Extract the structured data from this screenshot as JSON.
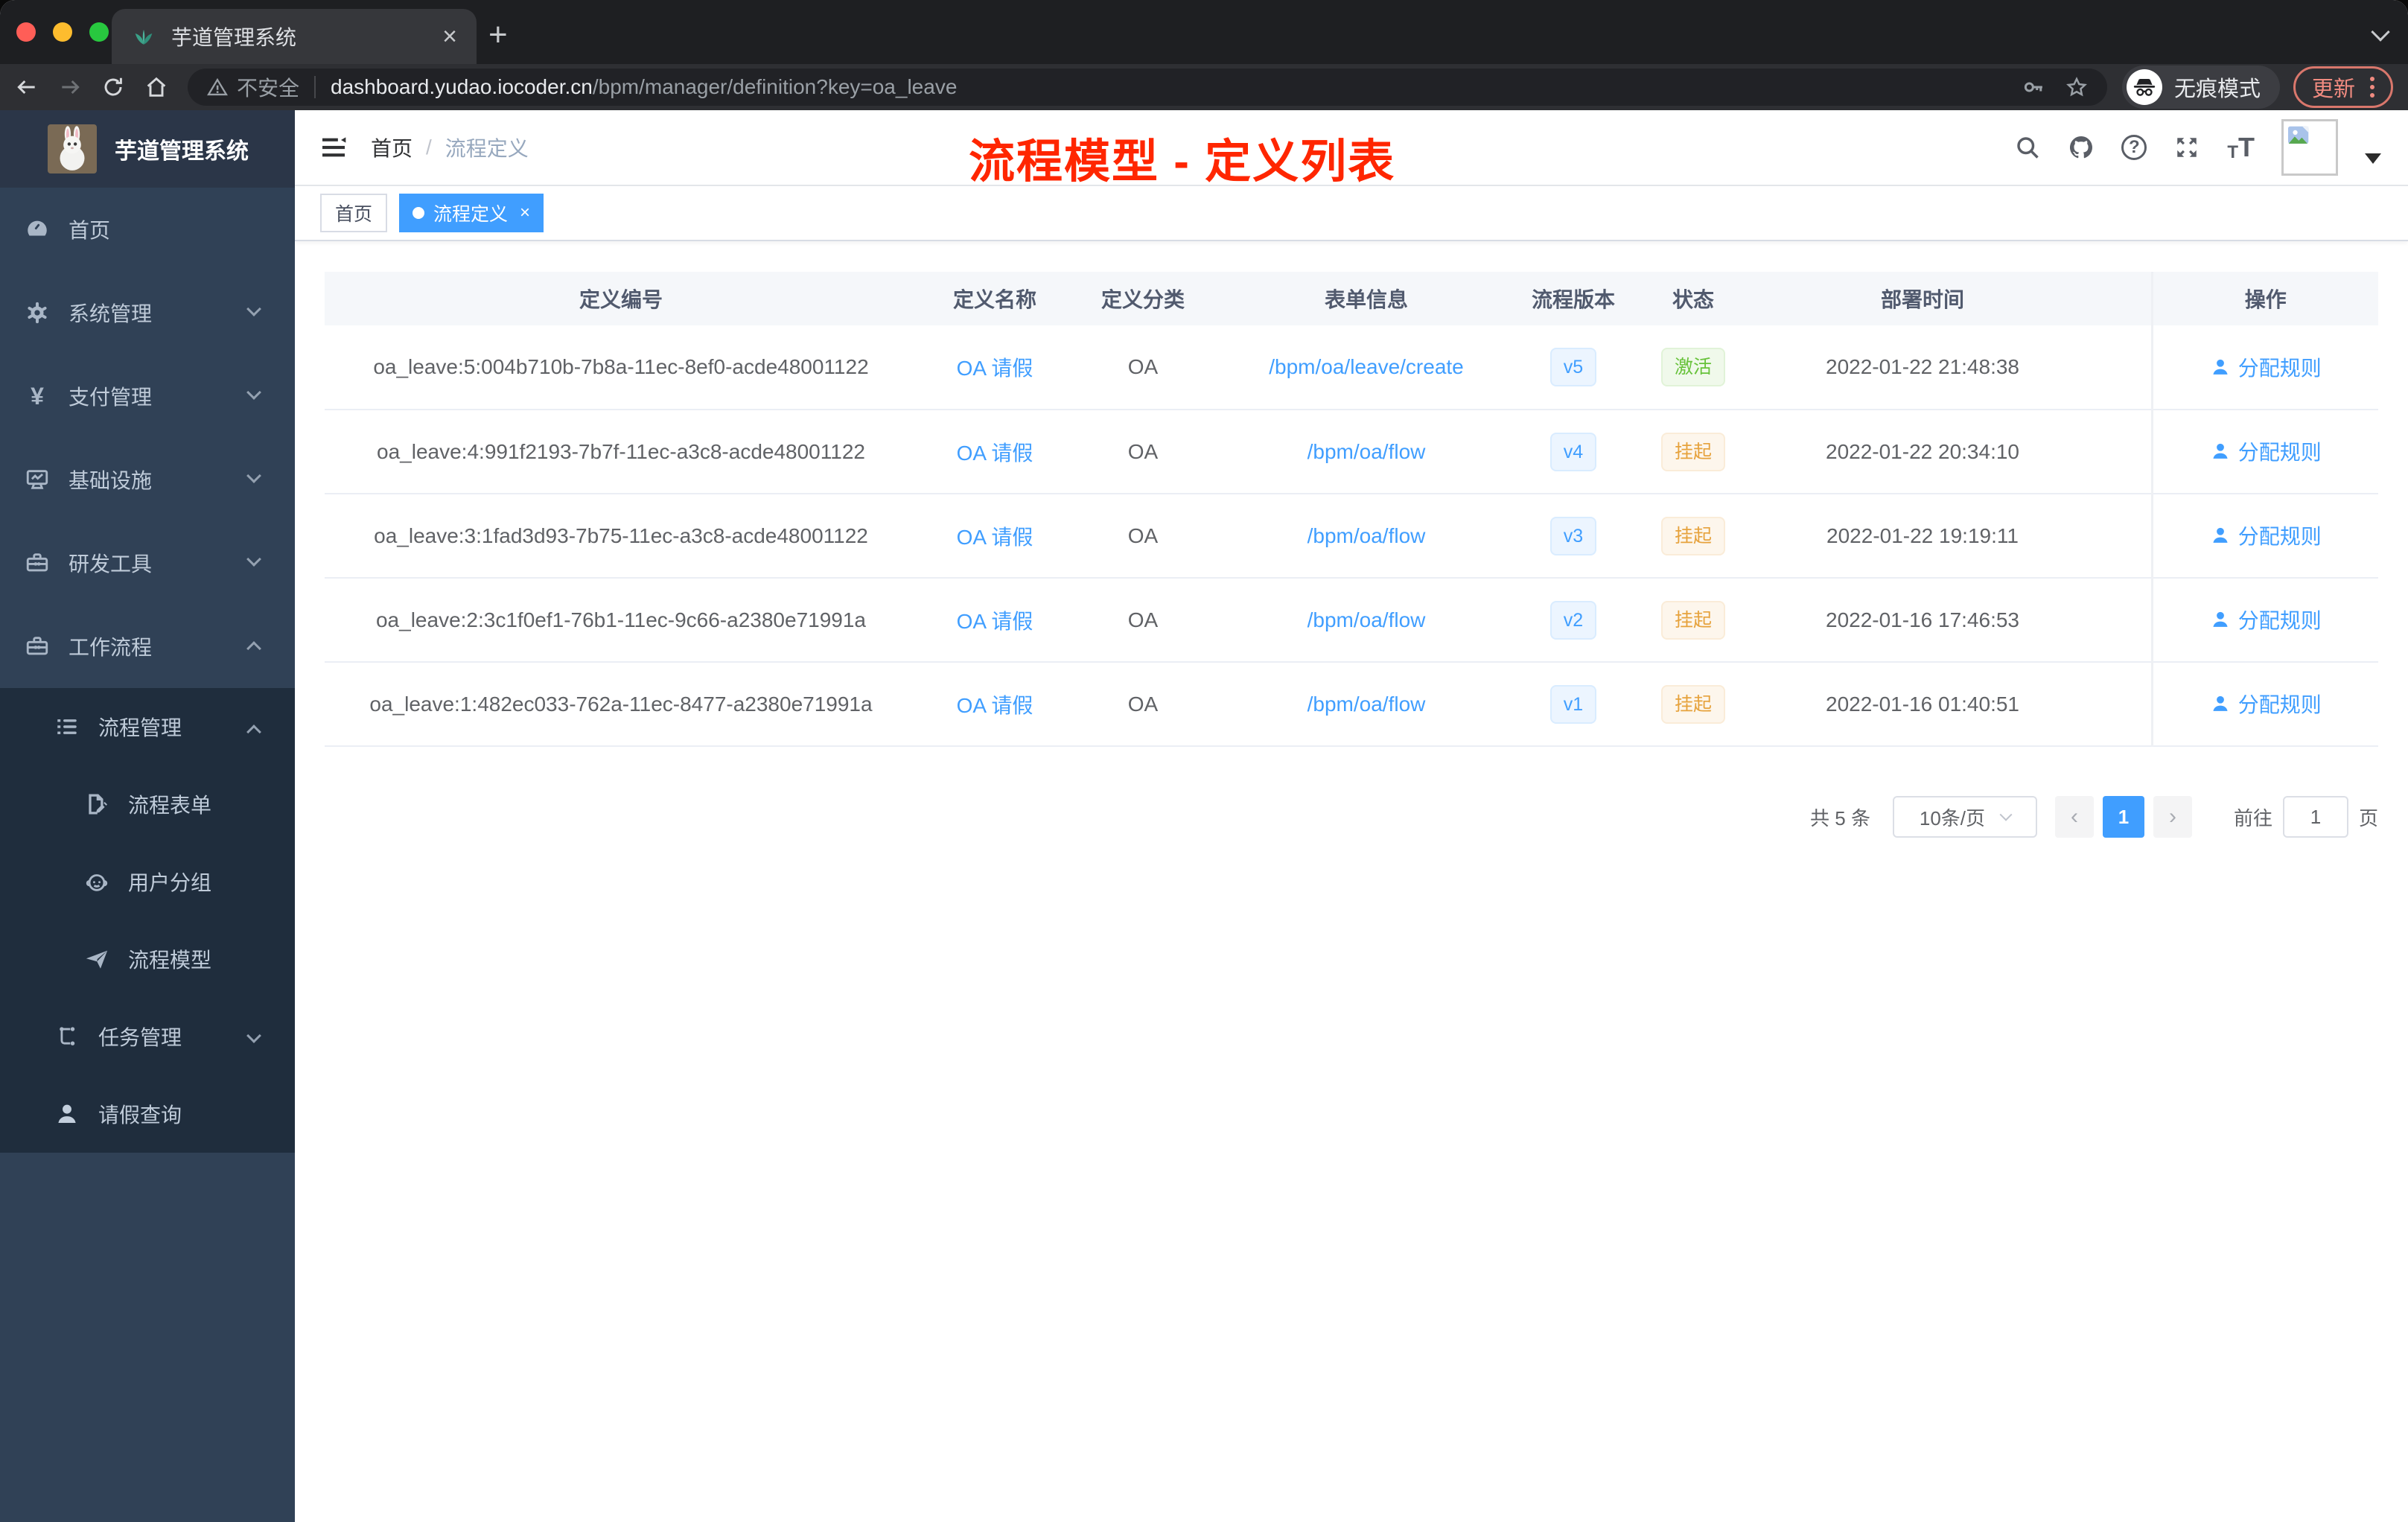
{
  "browser": {
    "tab_title": "芋道管理系统",
    "tab_close": "×",
    "new_tab": "+",
    "security_label": "不安全",
    "url_host": "dashboard.yudao.iocoder.cn",
    "url_path": "/bpm/manager/definition?key=oa_leave",
    "incognito_label": "无痕模式",
    "update_label": "更新"
  },
  "sidebar": {
    "title": "芋道管理系统",
    "yen_glyph": "¥",
    "items": [
      {
        "label": "首页"
      },
      {
        "label": "系统管理"
      },
      {
        "label": "支付管理"
      },
      {
        "label": "基础设施"
      },
      {
        "label": "研发工具"
      },
      {
        "label": "工作流程"
      },
      {
        "label": "流程管理"
      },
      {
        "label": "流程表单"
      },
      {
        "label": "用户分组"
      },
      {
        "label": "流程模型"
      },
      {
        "label": "任务管理"
      },
      {
        "label": "请假查询"
      }
    ]
  },
  "header": {
    "breadcrumb_home": "首页",
    "breadcrumb_sep": "/",
    "breadcrumb_current": "流程定义",
    "help_glyph": "?",
    "font_glyph_small": "T",
    "font_glyph_big": "T"
  },
  "tags": {
    "home": "首页",
    "active": "流程定义",
    "close": "×"
  },
  "annotation": {
    "text": "流程模型 - 定义列表",
    "color": "#ff2600"
  },
  "table": {
    "headers": [
      "定义编号",
      "定义名称",
      "定义分类",
      "表单信息",
      "流程版本",
      "状态",
      "部署时间",
      "操作"
    ],
    "rows": [
      {
        "id": "oa_leave:5:004b710b-7b8a-11ec-8ef0-acde48001122",
        "name": "OA 请假",
        "category": "OA",
        "form": "/bpm/oa/leave/create",
        "version": "v5",
        "status": "激活",
        "time": "2022-01-22 21:48:38",
        "action": "分配规则"
      },
      {
        "id": "oa_leave:4:991f2193-7b7f-11ec-a3c8-acde48001122",
        "name": "OA 请假",
        "category": "OA",
        "form": "/bpm/oa/flow",
        "version": "v4",
        "status": "挂起",
        "time": "2022-01-22 20:34:10",
        "action": "分配规则"
      },
      {
        "id": "oa_leave:3:1fad3d93-7b75-11ec-a3c8-acde48001122",
        "name": "OA 请假",
        "category": "OA",
        "form": "/bpm/oa/flow",
        "version": "v3",
        "status": "挂起",
        "time": "2022-01-22 19:19:11",
        "action": "分配规则"
      },
      {
        "id": "oa_leave:2:3c1f0ef1-76b1-11ec-9c66-a2380e71991a",
        "name": "OA 请假",
        "category": "OA",
        "form": "/bpm/oa/flow",
        "version": "v2",
        "status": "挂起",
        "time": "2022-01-16 17:46:53",
        "action": "分配规则"
      },
      {
        "id": "oa_leave:1:482ec033-762a-11ec-8477-a2380e71991a",
        "name": "OA 请假",
        "category": "OA",
        "form": "/bpm/oa/flow",
        "version": "v1",
        "status": "挂起",
        "time": "2022-01-16 01:40:51",
        "action": "分配规则"
      }
    ]
  },
  "pagination": {
    "total": "共 5 条",
    "page_size": "10条/页",
    "prev": "‹",
    "current": "1",
    "next": "›",
    "goto_label": "前往",
    "goto_value": "1",
    "unit": "页"
  },
  "colors": {
    "accent": "#409eff",
    "status_active": "#67c23a",
    "status_suspend": "#e6a23c",
    "sidebar_bg": "#304156",
    "submenu_bg": "#1f2d3d",
    "annotation_red": "#ff2600"
  }
}
